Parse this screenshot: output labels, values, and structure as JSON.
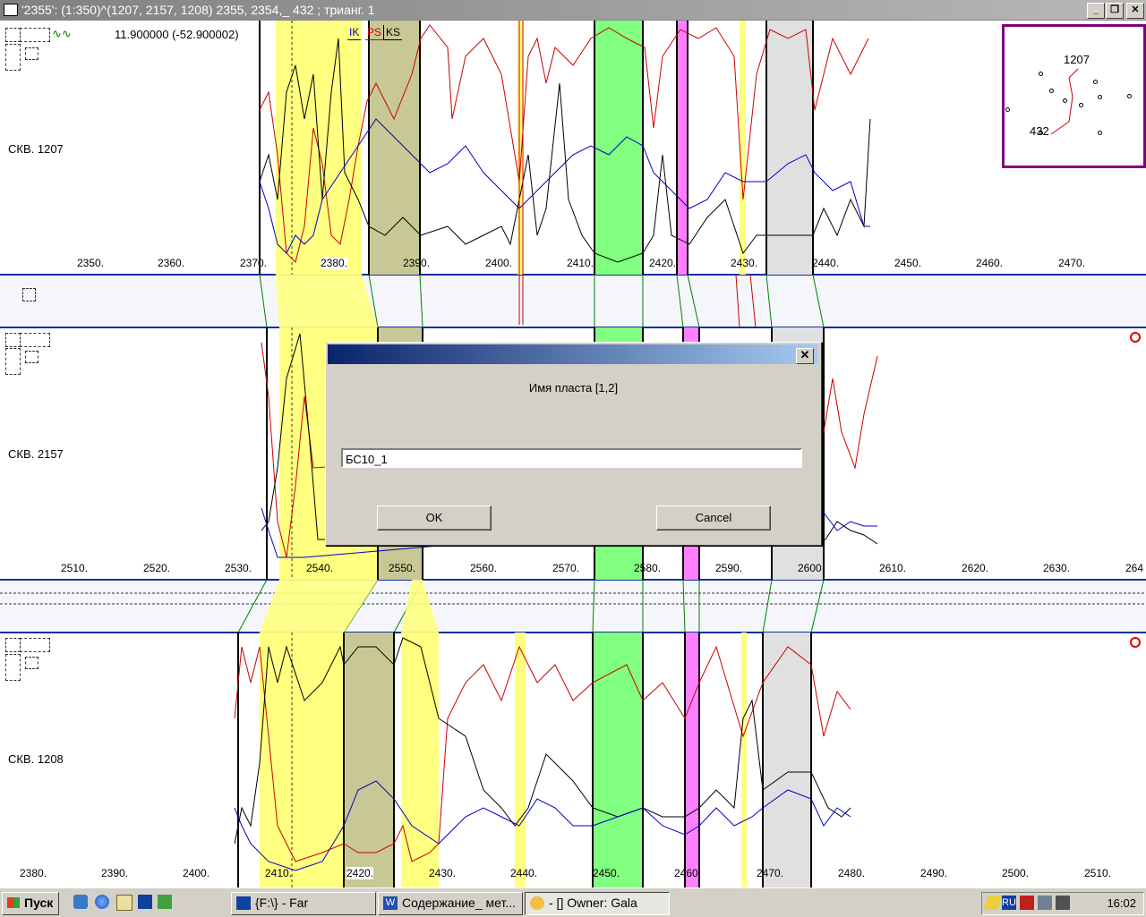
{
  "window": {
    "title": "'2355': (1:350)^(1207, 2157, 1208) 2355, 2354,_ 432 ; трианг. 1",
    "controls": [
      "_",
      "❐",
      "✕"
    ]
  },
  "header": {
    "cursor_readout": "11.900000 (-52.900002)",
    "legend": [
      {
        "label": "IK",
        "color": "#0000cc"
      },
      {
        "label": "PS",
        "color": "#cc0000"
      },
      {
        "label": "KS",
        "color": "#000000"
      }
    ]
  },
  "wells": [
    {
      "name": "СКВ. 1207",
      "depths": [
        "2350.",
        "2360.",
        "2370.",
        "2380.",
        "2390.",
        "2400.",
        "2410.",
        "2420.",
        "2430.",
        "2440.",
        "2450.",
        "2460.",
        "2470."
      ]
    },
    {
      "name": "СКВ. 2157",
      "depths": [
        "2510.",
        "2520.",
        "2530.",
        "2540.",
        "2550.",
        "2560.",
        "2570.",
        "2580.",
        "2590.",
        "2600.",
        "2610.",
        "2620.",
        "2630.",
        "264"
      ]
    },
    {
      "name": "СКВ. 1208",
      "depths": [
        "2380.",
        "2390.",
        "2400.",
        "2410.",
        "2420.",
        "2430.",
        "2440.",
        "2450.",
        "2460.",
        "2470.",
        "2480.",
        "2490.",
        "2500.",
        "2510."
      ]
    }
  ],
  "minimap": {
    "labels": [
      "1207",
      "432"
    ]
  },
  "colors": {
    "yellow_layer": "#ffff80",
    "olive_layer": "#c8c896",
    "green_layer": "#80ff80",
    "pink_layer": "#ff80ff",
    "gray_layer": "#e0e0e0",
    "curve_ik": "#0000cc",
    "curve_ps": "#cc0000",
    "curve_ks": "#000000"
  },
  "dialog": {
    "close_label": "✕",
    "prompt": "Имя пласта [1,2]",
    "input_value": "БС10_1",
    "ok_label": "OK",
    "cancel_label": "Cancel"
  },
  "taskbar": {
    "start_label": "Пуск",
    "tasks": [
      "{F:\\} - Far",
      "Содержание_ мет...",
      "- [] Owner: Gala"
    ],
    "tray": {
      "lang": "RU",
      "time": "16:02"
    }
  }
}
